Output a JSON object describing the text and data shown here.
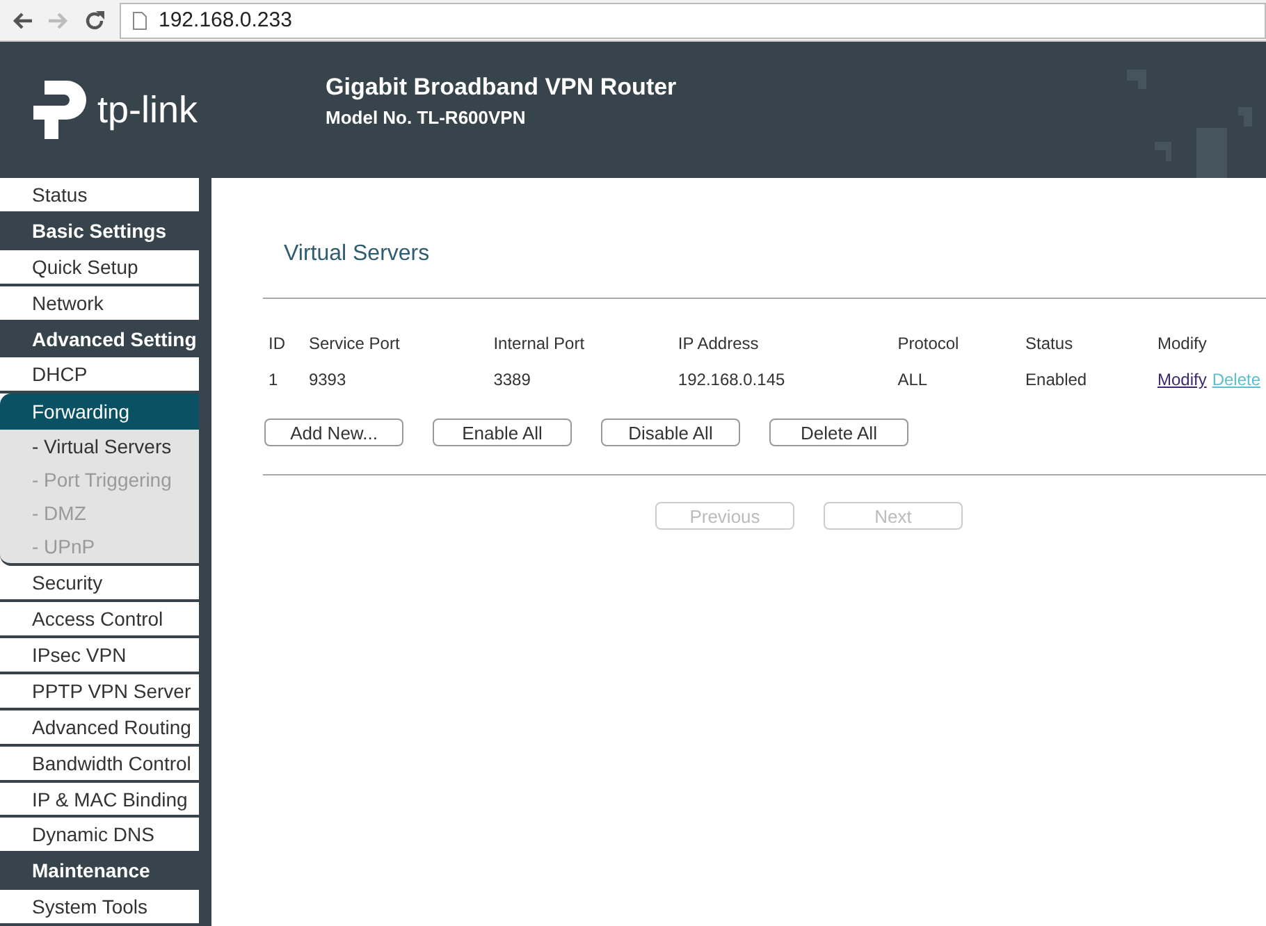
{
  "browser": {
    "address": "192.168.0.233"
  },
  "header": {
    "logo_text": "tp-link",
    "title": "Gigabit Broadband VPN Router",
    "model": "Model No. TL-R600VPN"
  },
  "sidebar": {
    "items": [
      {
        "kind": "item",
        "label": "Status",
        "selected": false
      },
      {
        "kind": "heading",
        "label": "Basic Settings"
      },
      {
        "kind": "item",
        "label": "Quick Setup",
        "selected": false
      },
      {
        "kind": "item",
        "label": "Network",
        "selected": false
      },
      {
        "kind": "heading",
        "label": "Advanced Setting"
      },
      {
        "kind": "item",
        "label": "DHCP",
        "selected": false
      },
      {
        "kind": "item",
        "label": "Forwarding",
        "selected": true,
        "children": [
          {
            "label": "- Virtual Servers",
            "selected": true
          },
          {
            "label": "- Port Triggering",
            "selected": false
          },
          {
            "label": "- DMZ",
            "selected": false
          },
          {
            "label": "- UPnP",
            "selected": false
          }
        ]
      },
      {
        "kind": "item",
        "label": "Security",
        "selected": false
      },
      {
        "kind": "item",
        "label": "Access Control",
        "selected": false
      },
      {
        "kind": "item",
        "label": "IPsec VPN",
        "selected": false
      },
      {
        "kind": "item",
        "label": "PPTP VPN Server",
        "selected": false
      },
      {
        "kind": "item",
        "label": "Advanced Routing",
        "selected": false
      },
      {
        "kind": "item",
        "label": "Bandwidth Control",
        "selected": false
      },
      {
        "kind": "item",
        "label": "IP & MAC Binding",
        "selected": false
      },
      {
        "kind": "item",
        "label": "Dynamic DNS",
        "selected": false
      },
      {
        "kind": "heading",
        "label": "Maintenance"
      },
      {
        "kind": "item",
        "label": "System Tools",
        "selected": false
      }
    ]
  },
  "content": {
    "title": "Virtual Servers",
    "table": {
      "columns": [
        "ID",
        "Service Port",
        "Internal Port",
        "IP Address",
        "Protocol",
        "Status",
        "Modify"
      ],
      "rows": [
        {
          "cells": [
            "1",
            "9393",
            "3389",
            "192.168.0.145",
            "ALL",
            "Enabled"
          ],
          "links": [
            {
              "label": "Modify",
              "visited": true
            },
            {
              "label": "Delete",
              "visited": false
            }
          ]
        }
      ]
    },
    "buttons": [
      {
        "label": "Add New...",
        "disabled": false
      },
      {
        "label": "Enable All",
        "disabled": false
      },
      {
        "label": "Disable All",
        "disabled": false
      },
      {
        "label": "Delete All",
        "disabled": false
      }
    ],
    "pager": [
      {
        "label": "Previous",
        "disabled": true
      },
      {
        "label": "Next",
        "disabled": true
      }
    ]
  }
}
